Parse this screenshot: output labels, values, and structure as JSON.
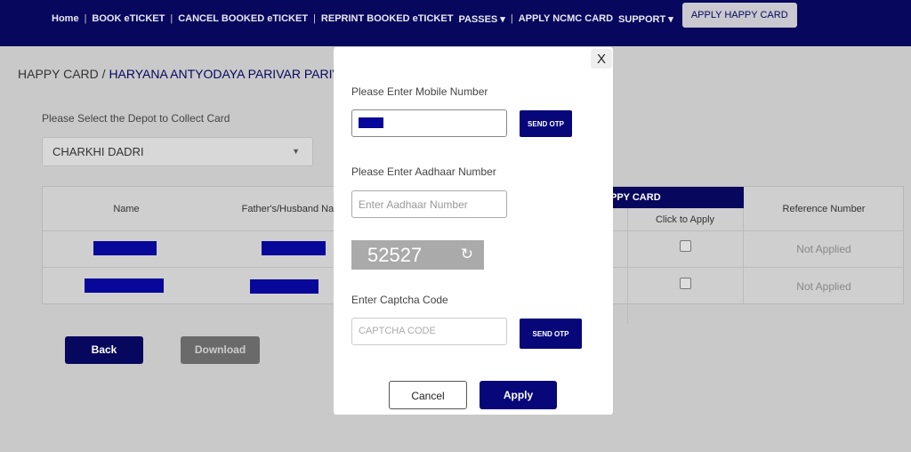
{
  "nav": {
    "items": [
      "Home",
      "BOOK eTICKET",
      "CANCEL BOOKED eTICKET",
      "REPRINT BOOKED eTICKET",
      "PASSES ▾",
      "APPLY NCMC CARD",
      "SUPPORT ▾"
    ],
    "active": "APPLY HAPPY CARD"
  },
  "breadcrumb": {
    "first": "HAPPY CARD /",
    "second": "HARYANA ANTYODAYA PARIVAR PARIVA"
  },
  "depot": {
    "label": "Please Select the Depot to Collect Card",
    "value": "CHARKHI DADRI"
  },
  "table": {
    "headers": {
      "name": "Name",
      "father": "Father's/Husband Nam",
      "group": "PPY CARD",
      "apply": "Click to Apply",
      "ref": "Reference Number"
    },
    "rows": [
      {
        "ref": "Not Applied"
      },
      {
        "ref": "Not Applied"
      }
    ]
  },
  "buttons": {
    "back": "Back",
    "download": "Download"
  },
  "modal": {
    "close": "X",
    "mobile_label": "Please Enter Mobile Number",
    "send_otp": "SEND OTP",
    "aadhaar_label": "Please Enter Aadhaar Number",
    "aadhaar_placeholder": "Enter Aadhaar Number",
    "captcha": "52527",
    "captcha_label": "Enter Captcha Code",
    "captcha_placeholder": "CAPTCHA CODE",
    "send_otp2": "SEND OTP",
    "cancel": "Cancel",
    "apply": "Apply"
  },
  "colors": {
    "navy": "#07075e",
    "accent": "#07077a"
  }
}
